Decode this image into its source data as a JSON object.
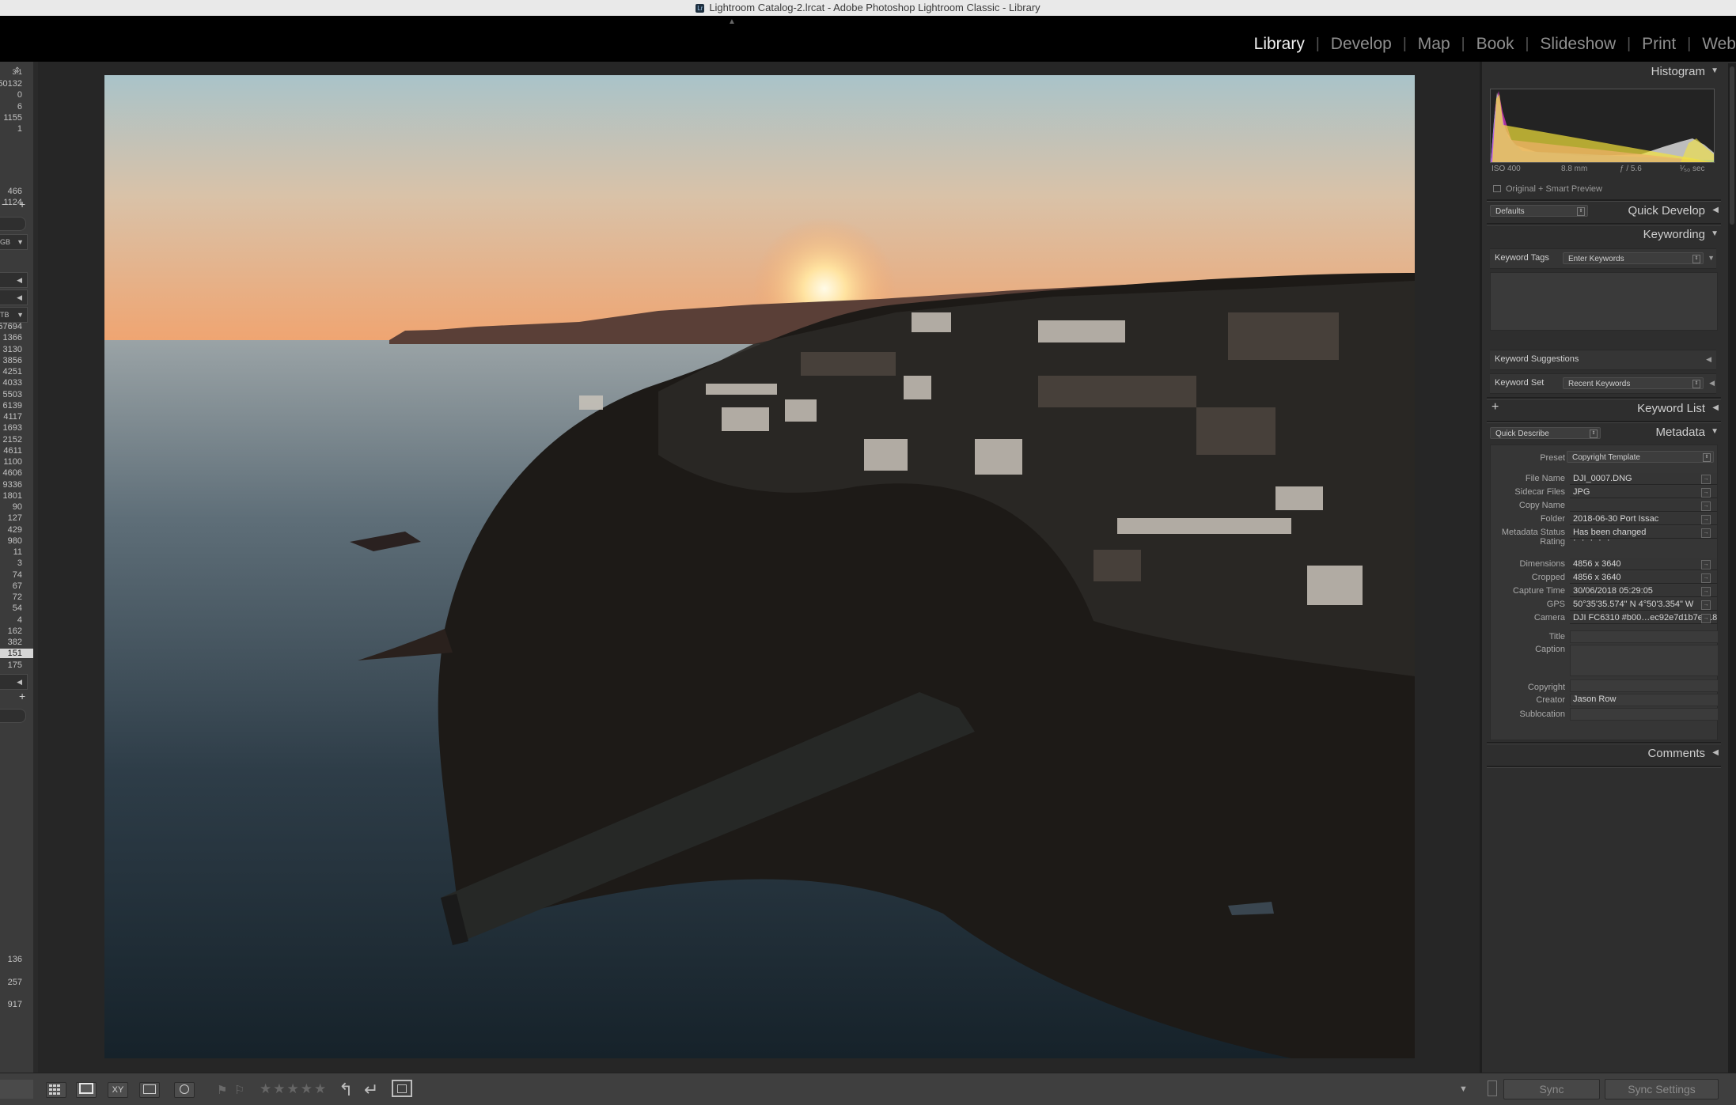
{
  "window": {
    "title": "Lightroom Catalog-2.lrcat - Adobe Photoshop Lightroom Classic - Library",
    "app_badge": "Lr"
  },
  "modules": [
    "Library",
    "Develop",
    "Map",
    "Book",
    "Slideshow",
    "Print",
    "Web"
  ],
  "active_module": "Library",
  "left_panel": {
    "zoom": "3:1",
    "counts_top": [
      "50132",
      "0",
      "6",
      "1155",
      "1"
    ],
    "counts_mid": [
      "466",
      "1124"
    ],
    "counts_list": [
      "57694",
      "1366",
      "3130",
      "3856",
      "4251",
      "4033",
      "5503",
      "6139",
      "4117",
      "1693",
      "2152",
      "4611",
      "1100",
      "4606",
      "9336",
      "1801",
      "90",
      "127",
      "429",
      "980",
      "11",
      "3",
      "74",
      "67",
      "72",
      "54",
      "4",
      "162",
      "382",
      "151",
      "175"
    ],
    "highlighted_count": "151",
    "counts_bottom": [
      "136",
      "257",
      "917"
    ],
    "dd_gb": "GB",
    "dd_tb": "TB",
    "minus": "−",
    "plus": "+"
  },
  "histogram": {
    "header": "Histogram",
    "iso": "ISO 400",
    "focal": "8.8 mm",
    "aperture": "ƒ / 5.6",
    "shutter": "¹⁄₅₀ sec",
    "preview_status": "Original + Smart Preview"
  },
  "quick_develop": {
    "header": "Quick Develop",
    "preset": "Defaults"
  },
  "keywording": {
    "header": "Keywording",
    "tags_label": "Keyword Tags",
    "tags_value": "Enter Keywords",
    "suggestions_label": "Keyword Suggestions",
    "set_label": "Keyword Set",
    "set_value": "Recent Keywords"
  },
  "keyword_list": {
    "header": "Keyword List",
    "add": "+"
  },
  "metadata": {
    "header": "Metadata",
    "view": "Quick Describe",
    "preset_label": "Preset",
    "preset_value": "Copyright Template",
    "fields": [
      {
        "label": "File Name",
        "value": "DJI_0007.DNG"
      },
      {
        "label": "Sidecar Files",
        "value": "JPG"
      },
      {
        "label": "Copy Name",
        "value": ""
      },
      {
        "label": "Folder",
        "value": "2018-06-30 Port Issac"
      },
      {
        "label": "Metadata Status",
        "value": "Has been changed"
      }
    ],
    "rating_label": "Rating",
    "rating_value": "· · · · ·",
    "fields2": [
      {
        "label": "Dimensions",
        "value": "4856 x 3640"
      },
      {
        "label": "Cropped",
        "value": "4856 x 3640"
      },
      {
        "label": "Capture Time",
        "value": "30/06/2018 05:29:05"
      },
      {
        "label": "GPS",
        "value": "50°35'35.574\" N 4°50'3.354\" W"
      },
      {
        "label": "Camera",
        "value": "DJI FC6310 #b00…ec92e7d1b7e918"
      }
    ],
    "title_label": "Title",
    "caption_label": "Caption",
    "copyright_label": "Copyright",
    "creator_label": "Creator",
    "creator_value": "Jason Row",
    "sublocation_label": "Sublocation"
  },
  "comments": {
    "header": "Comments"
  },
  "toolbar": {
    "grid_icon": "grid-view-icon",
    "loupe_icon": "loupe-view-icon",
    "compare_label": "XY",
    "rating_stars": "★★★★★",
    "sync_label": "Sync",
    "sync_settings_label": "Sync Settings"
  }
}
